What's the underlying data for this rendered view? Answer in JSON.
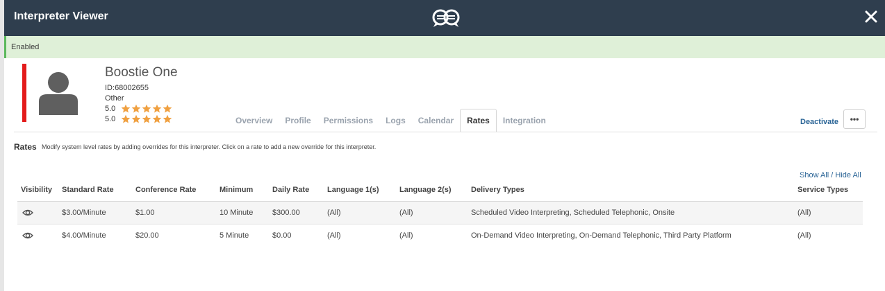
{
  "window": {
    "title": "Interpreter Viewer",
    "logo_icon": "speech-bubbles-logo-icon",
    "close_icon": "close-icon"
  },
  "status": {
    "text": "Enabled",
    "color": "#dff0d8",
    "accent": "#5cb85c"
  },
  "profile": {
    "name": "Boostie One",
    "id_label": "ID:",
    "id_value": "68002655",
    "type": "Other",
    "ratings": [
      {
        "value": "5.0",
        "stars": 5
      },
      {
        "value": "5.0",
        "stars": 5
      }
    ],
    "status_color": "#e31b1b"
  },
  "tabs": [
    {
      "label": "Overview",
      "active": false
    },
    {
      "label": "Profile",
      "active": false
    },
    {
      "label": "Permissions",
      "active": false
    },
    {
      "label": "Logs",
      "active": false
    },
    {
      "label": "Calendar",
      "active": false
    },
    {
      "label": "Rates",
      "active": true
    },
    {
      "label": "Integration",
      "active": false
    }
  ],
  "actions": {
    "deactivate_label": "Deactivate",
    "more_label": "•••"
  },
  "rates_section": {
    "title": "Rates",
    "description": "Modify system level rates by adding overrides for this interpreter. Click on a rate to add a new override for this interpreter.",
    "show_all": "Show All",
    "separator": "/",
    "hide_all": "Hide All",
    "columns": [
      "Visibility",
      "Standard Rate",
      "Conference Rate",
      "Minimum",
      "Daily Rate",
      "Language 1(s)",
      "Language 2(s)",
      "Delivery Types",
      "Service Types"
    ],
    "rows": [
      {
        "visibility_icon": "eye-icon",
        "standard_rate": "$3.00/Minute",
        "conference_rate": "$1.00",
        "minimum": "10 Minute",
        "daily_rate": "$300.00",
        "language1": "(All)",
        "language2": "(All)",
        "delivery_types": "Scheduled Video Interpreting, Scheduled Telephonic, Onsite",
        "service_types": "(All)"
      },
      {
        "visibility_icon": "eye-icon",
        "standard_rate": "$4.00/Minute",
        "conference_rate": "$20.00",
        "minimum": "5 Minute",
        "daily_rate": "$0.00",
        "language1": "(All)",
        "language2": "(All)",
        "delivery_types": "On-Demand Video Interpreting, On-Demand Telephonic, Third Party Platform",
        "service_types": "(All)"
      }
    ]
  },
  "colors": {
    "header_bg": "#2f3e4e",
    "link": "#2a6496",
    "star": "#f0a040"
  }
}
